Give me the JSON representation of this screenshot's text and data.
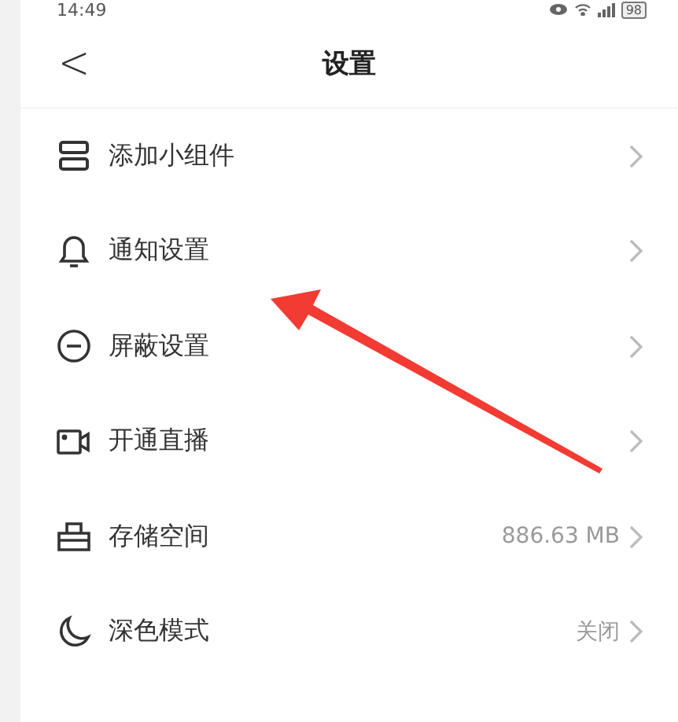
{
  "status_bar": {
    "time": "14:49",
    "battery": "98"
  },
  "header": {
    "title": "设置",
    "back": "<"
  },
  "items": [
    {
      "label": "添加小组件"
    },
    {
      "label": "通知设置"
    },
    {
      "label": "屏蔽设置"
    },
    {
      "label": "开通直播"
    },
    {
      "label": "存储空间",
      "value": "886.63 MB"
    },
    {
      "label": "深色模式",
      "value": "关闭"
    }
  ],
  "annotation": {
    "kind": "arrow",
    "color": "#f23b33"
  }
}
